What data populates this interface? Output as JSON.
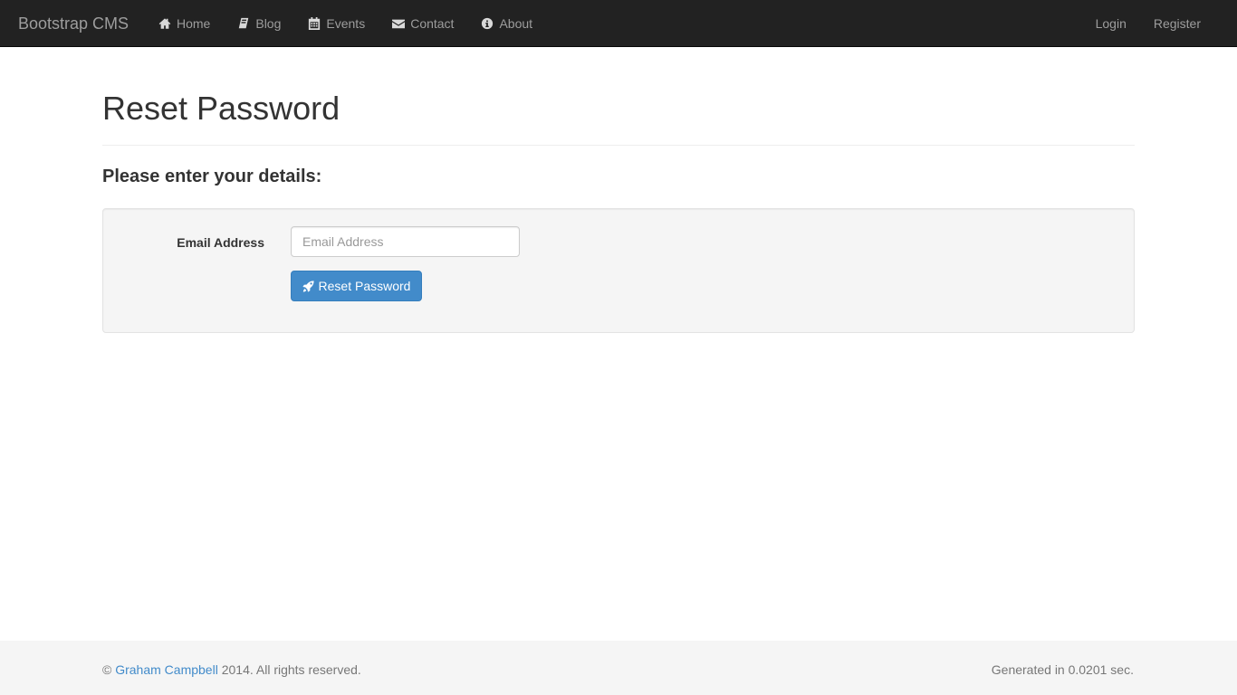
{
  "navbar": {
    "brand": "Bootstrap CMS",
    "left_items": [
      {
        "label": "Home",
        "icon": "home-icon"
      },
      {
        "label": "Blog",
        "icon": "book-icon"
      },
      {
        "label": "Events",
        "icon": "calendar-icon"
      },
      {
        "label": "Contact",
        "icon": "envelope-icon"
      },
      {
        "label": "About",
        "icon": "info-icon"
      }
    ],
    "right_items": [
      {
        "label": "Login"
      },
      {
        "label": "Register"
      }
    ]
  },
  "main": {
    "title": "Reset Password",
    "subtitle": "Please enter your details:",
    "form": {
      "email_label": "Email Address",
      "email_value": "",
      "email_placeholder": "Email Address",
      "submit_label": "Reset Password",
      "submit_icon": "rocket-icon"
    }
  },
  "footer": {
    "copyright_symbol": "©",
    "author_link": "Graham Campbell",
    "rights_text": "2014. All rights reserved.",
    "generated_text": "Generated in 0.0201 sec."
  },
  "colors": {
    "navbar_bg": "#222222",
    "nav_text": "#9d9d9d",
    "primary_button": "#428bca",
    "link": "#428bca",
    "well_bg": "#f5f5f5"
  }
}
